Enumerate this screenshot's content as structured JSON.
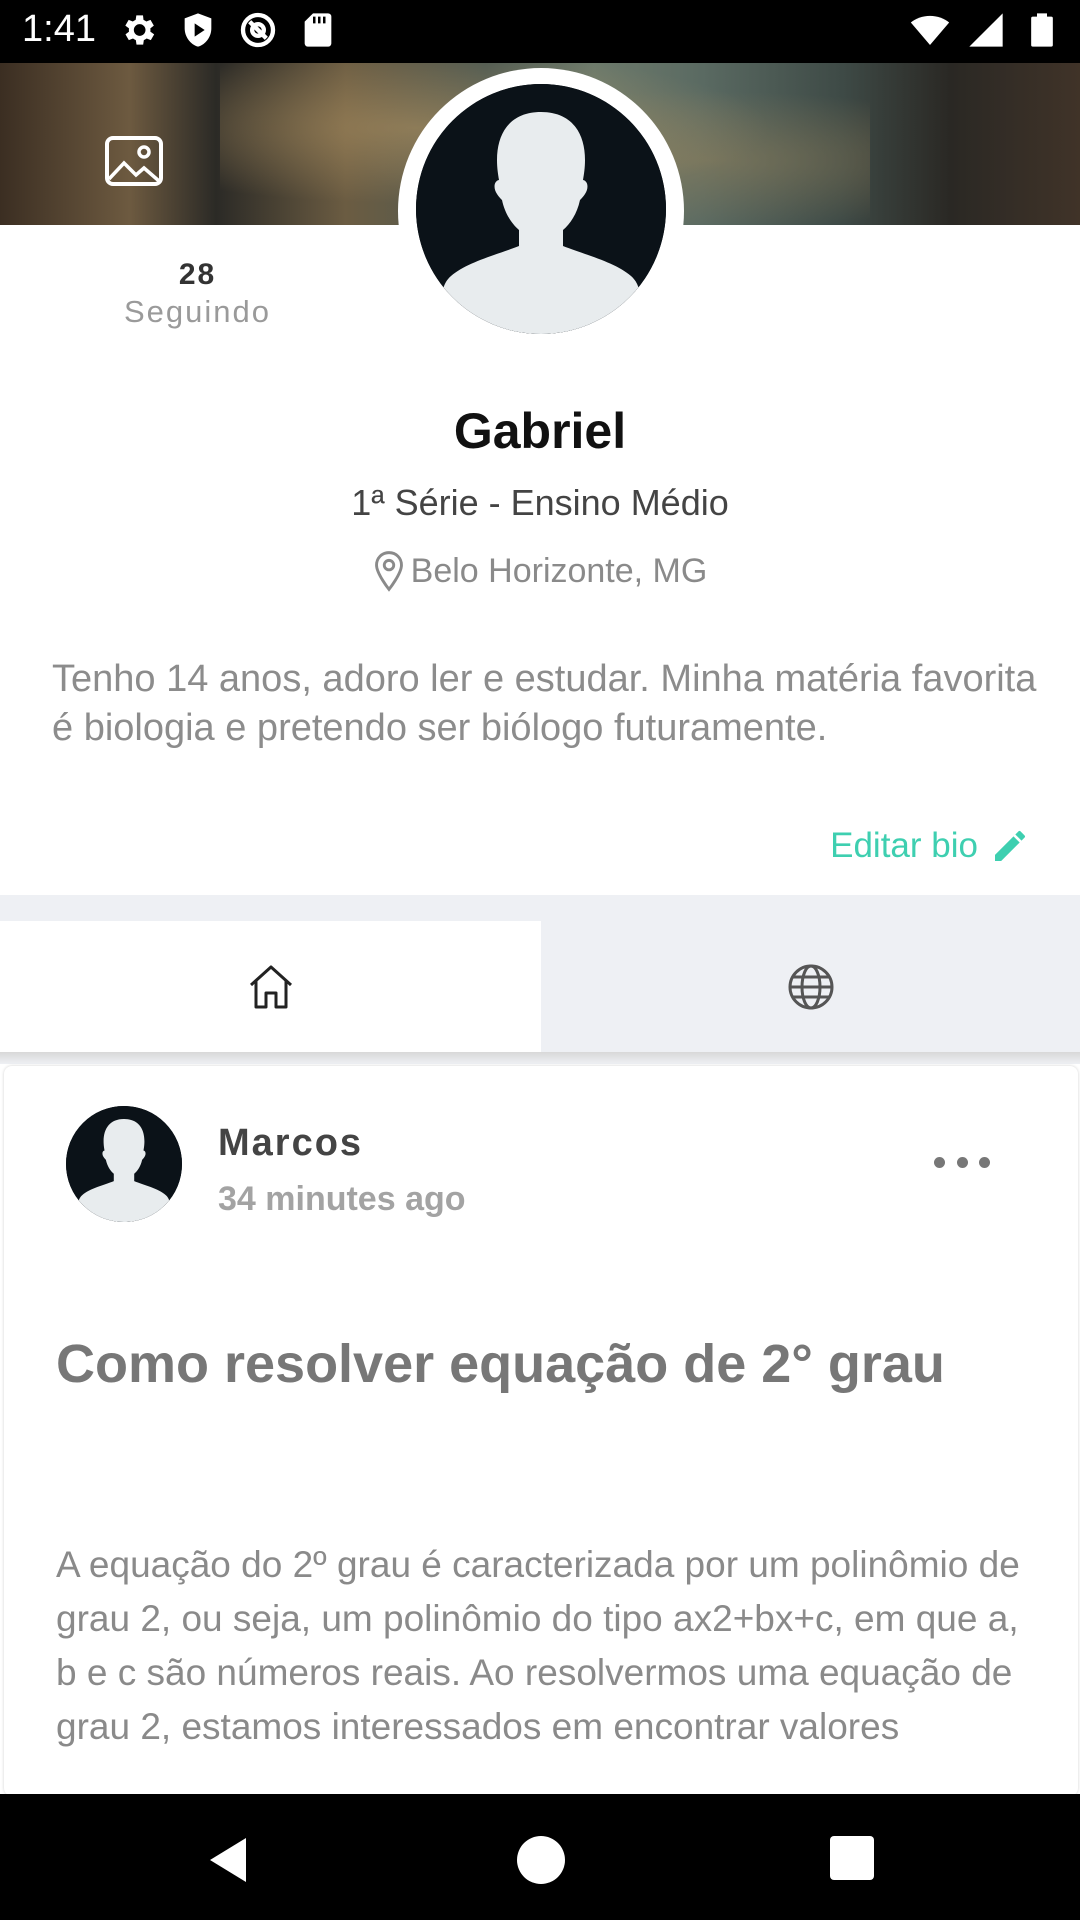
{
  "status_bar": {
    "time": "1:41",
    "left_icons": [
      "settings-icon",
      "play-protect-icon",
      "at-sign-icon",
      "sd-card-icon"
    ],
    "right_icons": [
      "wifi-icon",
      "cell-signal-icon",
      "battery-icon"
    ]
  },
  "profile": {
    "following_count": "28",
    "following_label": "Seguindo",
    "name": "Gabriel",
    "grade": "1ª Série - Ensino Médio",
    "location": "Belo Horizonte, MG",
    "bio": "Tenho 14 anos, adoro ler e estudar. Minha matéria favorita é biologia e pretendo ser biólogo futuramente.",
    "edit_bio_label": "Editar bio"
  },
  "tabs": [
    {
      "icon": "home-icon",
      "selected": true
    },
    {
      "icon": "globe-icon",
      "selected": false
    }
  ],
  "post": {
    "author": "Marcos",
    "time": "34 minutes ago",
    "title": "Como resolver equação de 2° grau",
    "body": "A equação do 2º grau é caracterizada por um polinômio de grau 2, ou seja, um polinômio do tipo ax2+bx+c, em que a, b e c são números reais. Ao resolvermos uma equação de grau 2, estamos interessados em encontrar valores"
  },
  "colors": {
    "accent": "#3ecfb0",
    "tabs_background": "#eef0f4",
    "avatar_dark": "#0b1218"
  }
}
